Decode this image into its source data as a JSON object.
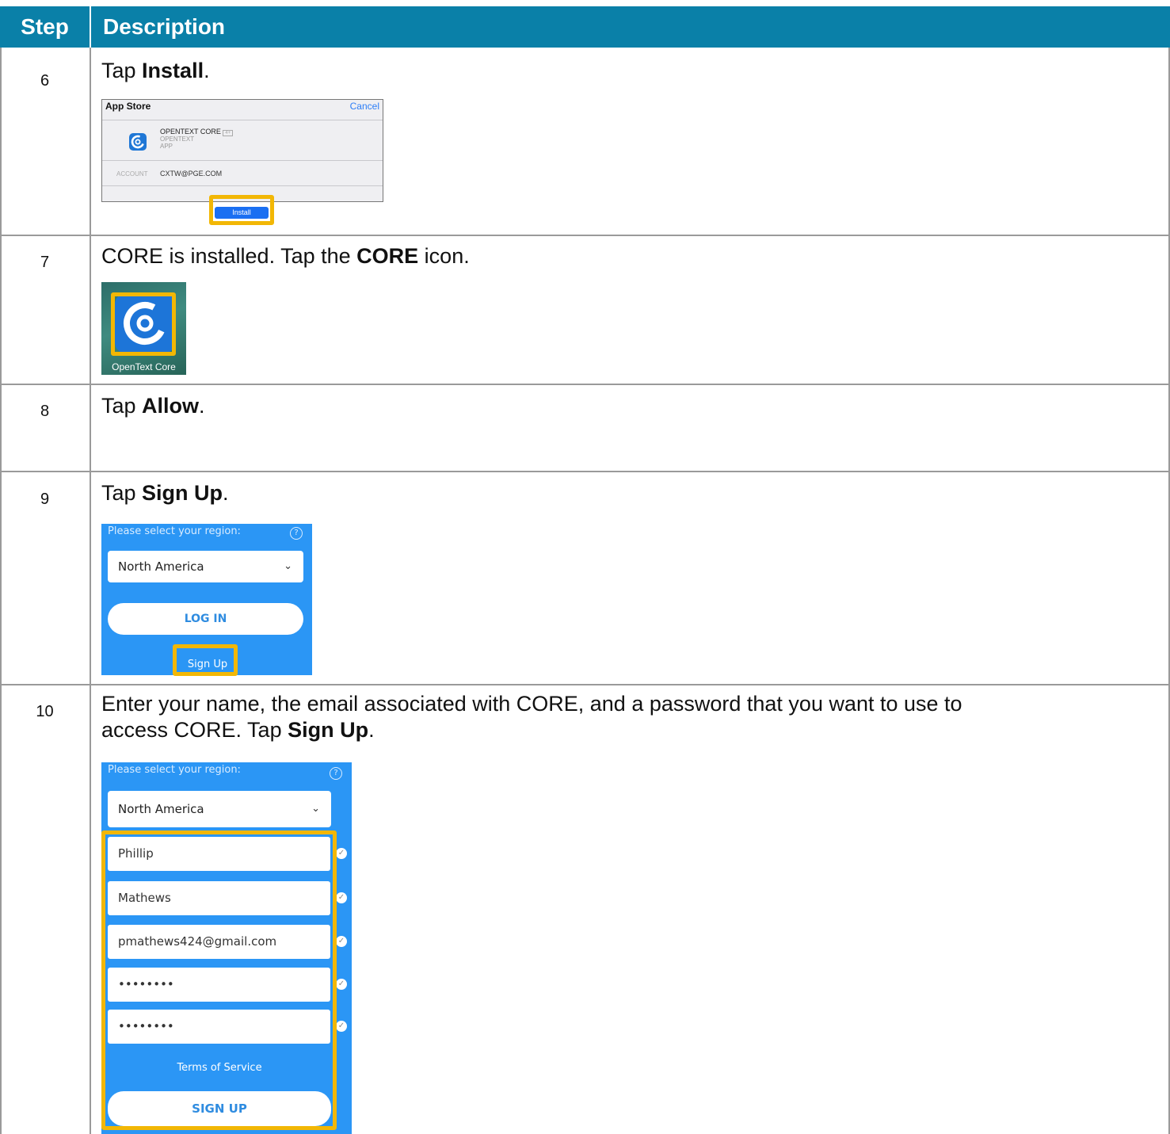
{
  "header": {
    "step": "Step",
    "description": "Description"
  },
  "rows": [
    {
      "step": "6",
      "pre": "Tap ",
      "bold": "Install",
      "post": ".",
      "screenshot": {
        "title": "App Store",
        "cancel": "Cancel",
        "app_name": "OPENTEXT CORE",
        "age_badge": "4+",
        "developer": "OPENTEXT",
        "type": "APP",
        "account_label": "ACCOUNT",
        "account_value": "CXTW@PGE.COM",
        "install": "Install"
      }
    },
    {
      "step": "7",
      "pre": "CORE is installed. Tap the ",
      "bold": "CORE",
      "post": " icon.",
      "screenshot": {
        "caption": "OpenText Core"
      }
    },
    {
      "step": "8",
      "pre": "Tap ",
      "bold": "Allow",
      "post": "."
    },
    {
      "step": "9",
      "pre": "Tap ",
      "bold": "Sign Up",
      "post": ".",
      "screenshot": {
        "prompt": "Please select your region:",
        "help": "?",
        "region": "North America",
        "login": "LOG IN",
        "signup_link": "Sign Up"
      }
    },
    {
      "step": "10",
      "line1": "Enter your name, the email associated with CORE, and a password that you want to use to",
      "pre": "access CORE. Tap ",
      "bold": "Sign Up",
      "post": ".",
      "screenshot": {
        "prompt": "Please select your region:",
        "help": "?",
        "region": "North America",
        "fields": [
          "Phillip",
          "Mathews",
          "pmathews424@gmail.com",
          "••••••••",
          "••••••••"
        ],
        "terms": "Terms of Service",
        "signup_button": "SIGN UP"
      }
    }
  ],
  "colors": {
    "header_bg": "#0a80a8",
    "highlight": "#f2b705",
    "phone_bg": "#2b96f5"
  }
}
